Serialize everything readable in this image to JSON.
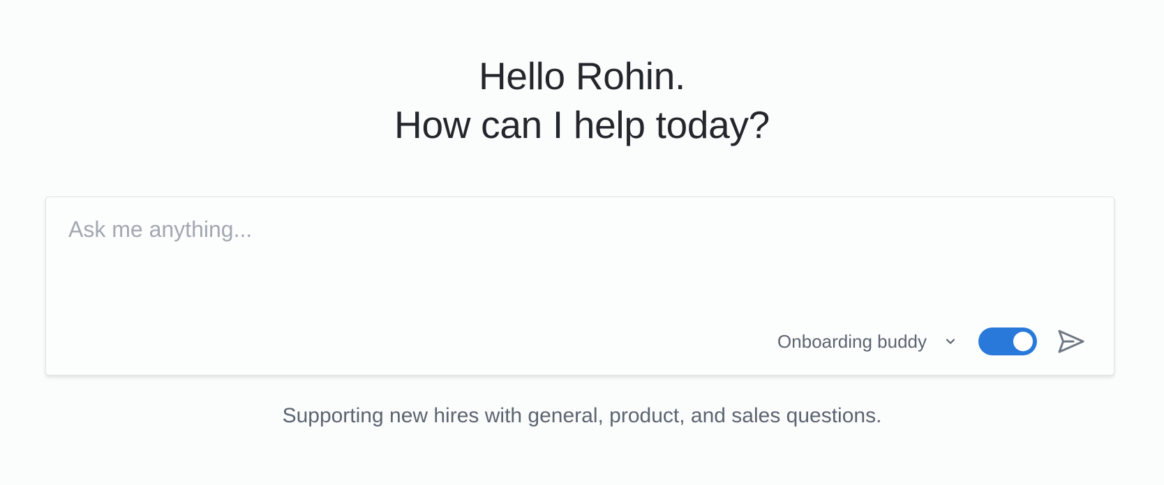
{
  "greeting": {
    "line1": "Hello Rohin.",
    "line2": "How can I help today?"
  },
  "composer": {
    "placeholder": "Ask me anything...",
    "value": "",
    "assistant": {
      "selected": "Onboarding buddy",
      "icon": "chevron-down-icon"
    },
    "toggle": {
      "on": true,
      "color": "#2979db"
    },
    "send": {
      "icon": "send-icon"
    }
  },
  "description": "Supporting new hires with general, product, and sales questions."
}
